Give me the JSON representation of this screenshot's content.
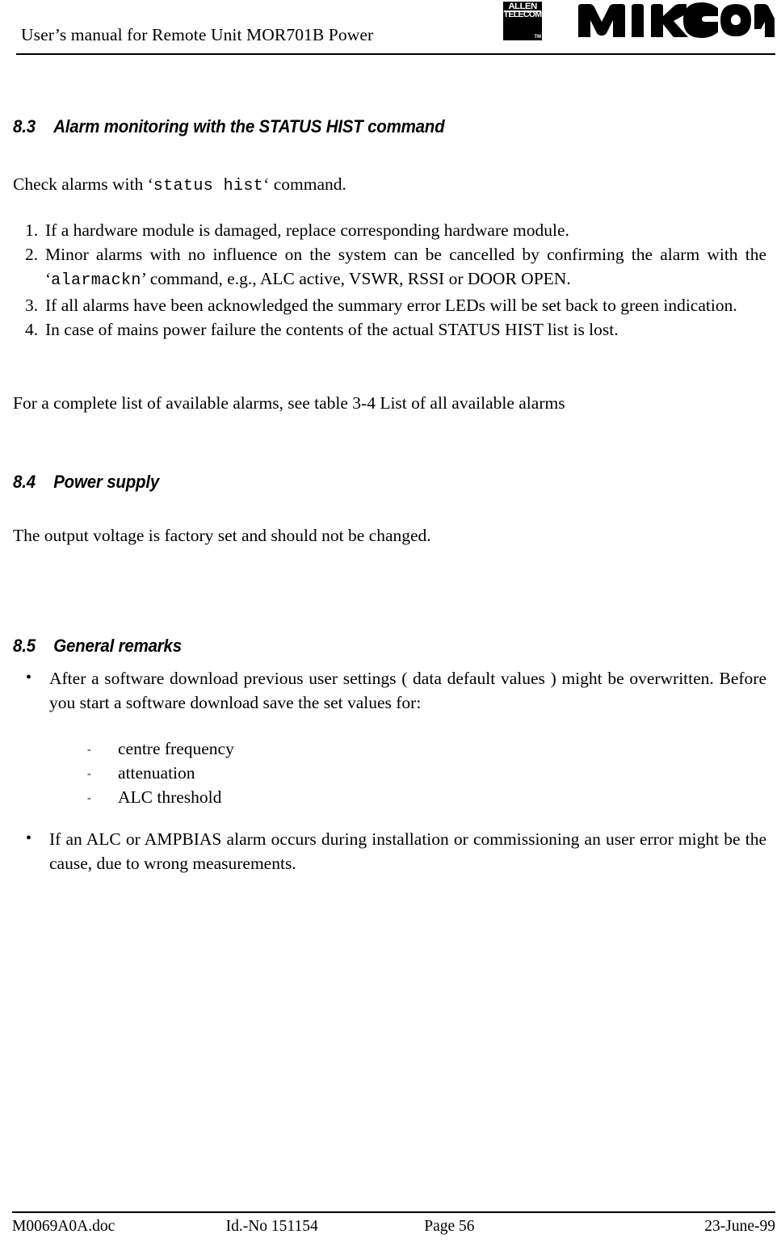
{
  "header": {
    "title": "User’s manual for Remote Unit MOR701B Power",
    "allen_logo": {
      "line1": "ALLEN",
      "line2": "TELECOM",
      "tm": "TM"
    },
    "mikom_logo": {
      "text": "MIKOM"
    }
  },
  "sections": [
    {
      "number": "8.3",
      "title": "Alarm monitoring with the STATUS HIST command",
      "intro": {
        "before": "Check alarms with ‘",
        "command": "status hist",
        "after": "‘ command."
      },
      "numbered_items": [
        {
          "marker": "1.",
          "text": "If a hardware module is damaged, replace corresponding hardware module."
        },
        {
          "marker": "2.",
          "before": "Minor alarms with no influence on the system can be cancelled by confirming the alarm with the ‘",
          "command": "alarmackn",
          "after": "’ command, e.g., ALC active, VSWR, RSSI or DOOR OPEN."
        },
        {
          "marker": "3.",
          "text": "If all alarms have been acknowledged the summary error LEDs will be set back to green indication."
        },
        {
          "marker": "4.",
          "text": "In case of mains power failure the contents of the actual STATUS HIST list is lost."
        }
      ],
      "closing": "For a complete list of available alarms, see table 3-4 List of all available alarms"
    },
    {
      "number": "8.4",
      "title": "Power supply",
      "body": "The output voltage is factory set and should not be changed."
    },
    {
      "number": "8.5",
      "title": "General remarks",
      "bullets": [
        {
          "marker": "•",
          "text": "After a software download previous user settings ( data default values ) might be overwritten. Before you start a software download save the set values for:"
        },
        {
          "marker": "•",
          "text": "If an ALC or AMPBIAS alarm occurs during installation or commissioning an user error might be the cause, due to wrong measurements."
        }
      ],
      "sub_items": [
        {
          "marker": "-",
          "text": "centre frequency"
        },
        {
          "marker": "-",
          "text": "attenuation"
        },
        {
          "marker": "-",
          "text": "ALC threshold"
        }
      ]
    }
  ],
  "footer": {
    "document": "M0069A0A.doc",
    "id_no": "Id.-No 151154",
    "page": "Page 56",
    "date": "23-June-99"
  }
}
